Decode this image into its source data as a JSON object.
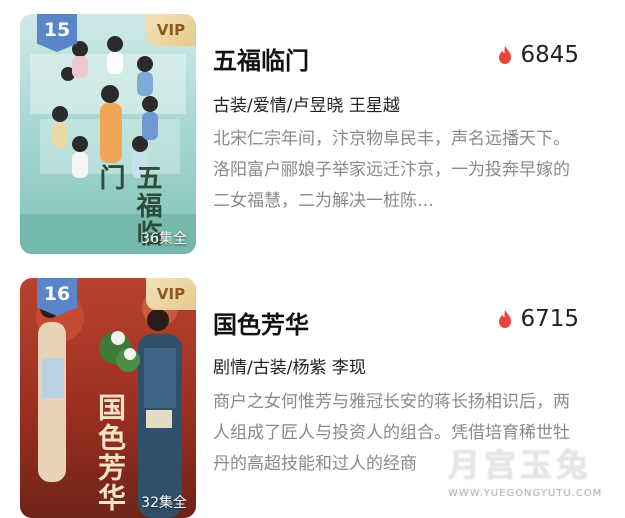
{
  "colors": {
    "rank_badge": "#5b85c9",
    "vip_badge_text": "#8a5a1e",
    "heat_icon": "#e8453c",
    "description_text": "#8a8a8a"
  },
  "dramas": [
    {
      "rank": "15",
      "vip_label": "VIP",
      "episodes": "36集全",
      "poster_title": "五福临门",
      "title": "五福临门",
      "heat_icon": "flame-icon",
      "heat": "6845",
      "tags": "古装/爱情/卢昱晓 王星越",
      "description": "北宋仁宗年间，汴京物阜民丰，声名远播天下。洛阳富户郦娘子举家远迁汴京，一为投奔早嫁的二女福慧，二为解决一桩陈…"
    },
    {
      "rank": "16",
      "vip_label": "VIP",
      "episodes": "32集全",
      "poster_title": "国色芳华",
      "title": "国色芳华",
      "heat_icon": "flame-icon",
      "heat": "6715",
      "tags": "剧情/古装/杨紫 李现",
      "description": "商户之女何惟芳与雅冠长安的蒋长扬相识后，两人组成了匠人与投资人的组合。凭借培育稀世牡丹的高超技能和过人的经商"
    }
  ],
  "watermark": {
    "main": "月宫玉兔",
    "url": "WWW.YUEGONGYUTU.COM"
  }
}
